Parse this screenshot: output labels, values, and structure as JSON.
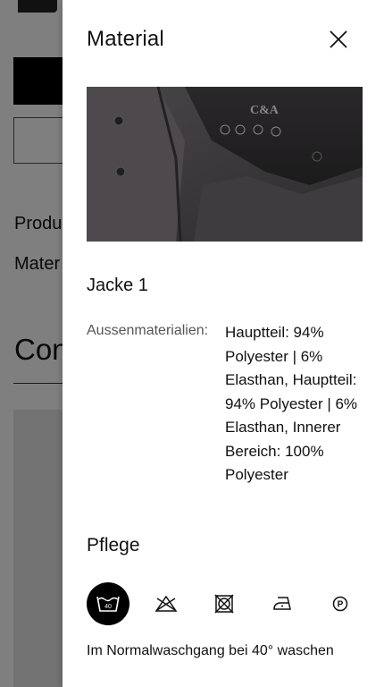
{
  "background": {
    "partial_label_1": "Produ",
    "partial_label_2": "Mater",
    "partial_heading": "Con"
  },
  "drawer": {
    "title": "Material",
    "close_icon": "close-icon",
    "image_alt": "C&A",
    "item_title": "Jacke 1",
    "material_label": "Aussenmaterialien:",
    "material_value": "Hauptteil: 94% Polyester | 6% Elasthan, Hauptteil: 94% Polyester | 6% Elasthan, Innerer Bereich: 100% Polyester",
    "care_title": "Pflege",
    "care_icons": [
      {
        "icon": "wash-40-icon",
        "label": "40",
        "active": true
      },
      {
        "icon": "no-bleach-icon",
        "active": false
      },
      {
        "icon": "no-tumble-dry-icon",
        "active": false
      },
      {
        "icon": "iron-low-icon",
        "active": false
      },
      {
        "icon": "professional-dry-clean-p-icon",
        "label": "P",
        "active": false
      }
    ],
    "care_description": "Im Normalwaschgang bei 40° waschen"
  },
  "colors": {
    "accent": "#000000",
    "overlay": "rgba(0,0,0,0.5)"
  }
}
